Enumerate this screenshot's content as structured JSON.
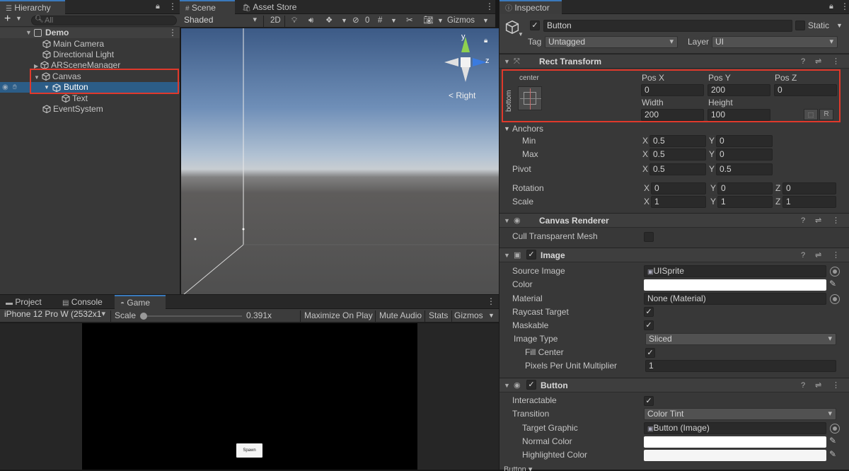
{
  "hierarchy": {
    "tab": "Hierarchy",
    "search_placeholder": "All",
    "add_label": "+",
    "scene": "Demo",
    "items": [
      "Main Camera",
      "Directional Light",
      "ARSceneManager",
      "Canvas",
      "Button",
      "Text",
      "EventSystem"
    ]
  },
  "scene_view": {
    "tabs": [
      "Scene",
      "Asset Store"
    ],
    "shading": "Shaded",
    "mode_2d": "2D",
    "hidden_count": "0",
    "gizmos": "Gizmos",
    "view_label": "< Right",
    "axis_y": "y",
    "axis_z": "z"
  },
  "bottom_tabs": [
    "Project",
    "Console",
    "Game"
  ],
  "game_view": {
    "device": "iPhone 12 Pro W (2532x1",
    "scale_label": "Scale",
    "scale_value": "0.391x",
    "scale_fraction": 0.3,
    "maximize": "Maximize On Play",
    "mute": "Mute Audio",
    "stats": "Stats",
    "gizmos": "Gizmos",
    "button_text": "Spawn"
  },
  "inspector": {
    "tab": "Inspector",
    "object_name": "Button",
    "static_label": "Static",
    "tag_label": "Tag",
    "tag_value": "Untagged",
    "layer_label": "Layer",
    "layer_value": "UI",
    "rect_transform": {
      "title": "Rect Transform",
      "anchor_h": "center",
      "anchor_v": "bottom",
      "pos_x_label": "Pos X",
      "pos_x": "0",
      "pos_y_label": "Pos Y",
      "pos_y": "200",
      "pos_z_label": "Pos Z",
      "pos_z": "0",
      "width_label": "Width",
      "width": "200",
      "height_label": "Height",
      "height": "100",
      "r_button": "R",
      "anchors_label": "Anchors",
      "min_label": "Min",
      "min_x": "0.5",
      "min_y": "0",
      "max_label": "Max",
      "max_x": "0.5",
      "max_y": "0",
      "pivot_label": "Pivot",
      "pivot_x": "0.5",
      "pivot_y": "0.5",
      "rotation_label": "Rotation",
      "rot_x": "0",
      "rot_y": "0",
      "rot_z": "0",
      "scale_label": "Scale",
      "scale_x": "1",
      "scale_y": "1",
      "scale_z": "1",
      "x": "X",
      "y": "Y",
      "z": "Z"
    },
    "canvas_renderer": {
      "title": "Canvas Renderer",
      "cull_label": "Cull Transparent Mesh"
    },
    "image": {
      "title": "Image",
      "source_label": "Source Image",
      "source_value": "UISprite",
      "color_label": "Color",
      "material_label": "Material",
      "material_value": "None (Material)",
      "raycast_label": "Raycast Target",
      "maskable_label": "Maskable",
      "type_label": "Image Type",
      "type_value": "Sliced",
      "fill_label": "Fill Center",
      "ppu_label": "Pixels Per Unit Multiplier",
      "ppu_value": "1"
    },
    "button": {
      "title": "Button",
      "interactable_label": "Interactable",
      "transition_label": "Transition",
      "transition_value": "Color Tint",
      "target_label": "Target Graphic",
      "target_value": "Button (Image)",
      "normal_label": "Normal Color",
      "highlighted_label": "Highlighted Color",
      "footer": "Button"
    }
  },
  "colors": {
    "accent": "#3a79bb",
    "selection": "#2c5d87",
    "highlight_box": "#e0392b"
  }
}
